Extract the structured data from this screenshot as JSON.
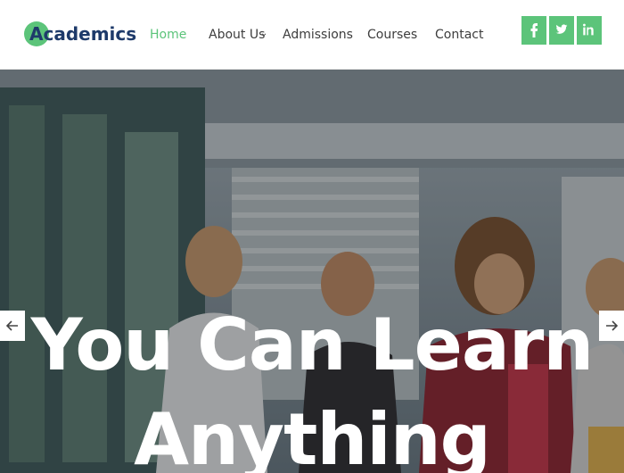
{
  "brand": {
    "name": "Academics",
    "color": "#5cc47a",
    "text_color": "#1e3a6a"
  },
  "nav": {
    "items": [
      {
        "label": "Home",
        "active": true
      },
      {
        "label": "About Us",
        "has_dropdown": true
      },
      {
        "label": "Admissions"
      },
      {
        "label": "Courses"
      },
      {
        "label": "Contact"
      }
    ]
  },
  "social": [
    {
      "icon": "facebook-icon"
    },
    {
      "icon": "twitter-icon"
    },
    {
      "icon": "linkedin-icon"
    }
  ],
  "hero": {
    "headline_line1": "You Can Learn",
    "headline_line2": "Anything",
    "prev_icon": "arrow-left-icon",
    "next_icon": "arrow-right-icon"
  }
}
